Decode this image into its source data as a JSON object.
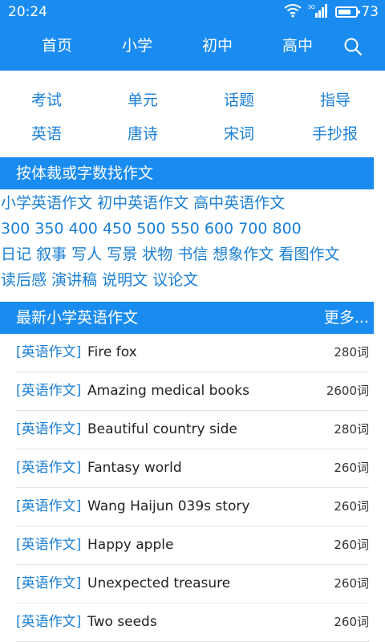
{
  "status": {
    "time": "20:24",
    "network": "3G",
    "battery_text": "73",
    "battery_level": 0.73
  },
  "nav": {
    "tabs": [
      "首页",
      "小学",
      "初中",
      "高中"
    ],
    "search_icon": "search-icon"
  },
  "categories": {
    "row1": [
      "考试",
      "单元",
      "话题",
      "指导"
    ],
    "row2": [
      "英语",
      "唐诗",
      "宋词",
      "手抄报"
    ]
  },
  "genre_section": {
    "title": "按体裁或字数找作文",
    "grades": [
      "小学英语作文",
      "初中英语作文",
      "高中英语作文"
    ],
    "word_counts": [
      "300",
      "350",
      "400",
      "450",
      "500",
      "550",
      "600",
      "700",
      "800"
    ],
    "genres_row1": [
      "日记",
      "叙事",
      "写人",
      "写景",
      "状物",
      "书信",
      "想象作文",
      "看图作文"
    ],
    "genres_row2": [
      "读后感",
      "演讲稿",
      "说明文",
      "议论文"
    ]
  },
  "latest_section": {
    "title": "最新小学英语作文",
    "more_label": "更多...",
    "articles": [
      {
        "tag": "[英语作文]",
        "title": "Fire fox",
        "words": "280词"
      },
      {
        "tag": "[英语作文]",
        "title": "Amazing medical books",
        "words": "2600词"
      },
      {
        "tag": "[英语作文]",
        "title": "Beautiful country side",
        "words": "280词"
      },
      {
        "tag": "[英语作文]",
        "title": "Fantasy world",
        "words": "260词"
      },
      {
        "tag": "[英语作文]",
        "title": "Wang Haijun 039s story",
        "words": "260词"
      },
      {
        "tag": "[英语作文]",
        "title": "Happy apple",
        "words": "260词"
      },
      {
        "tag": "[英语作文]",
        "title": "Unexpected treasure",
        "words": "260词"
      },
      {
        "tag": "[英语作文]",
        "title": "Two seeds",
        "words": "260词"
      }
    ]
  },
  "colors": {
    "primary": "#1a8cf0",
    "link": "#1a7fd4",
    "divider": "#e4e4e4"
  }
}
